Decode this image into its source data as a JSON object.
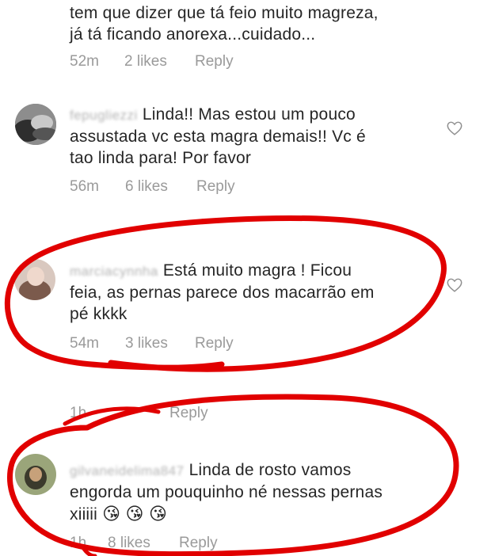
{
  "accent_color": "#e10000",
  "comments": [
    {
      "username": "",
      "text_line1": "tem que dizer que tá feio muito magreza,",
      "text_line2": "já tá ficando anorexa...cuidado...",
      "time": "52m",
      "likes": "2 likes",
      "reply": "Reply"
    },
    {
      "username": "fepugliezzi",
      "text_line1": "Linda!! Mas estou  um pouco",
      "text_line2": "assustada vc esta magra demais!! Vc é",
      "text_line3": "tao linda para! Por favor",
      "time": "56m",
      "likes": "6 likes",
      "reply": "Reply",
      "heart_icon": "heart-outline-icon"
    },
    {
      "username": "marciacynnha",
      "text_line1": "Está muito magra ! Ficou",
      "text_line2": "feia, as pernas parece dos macarrão em",
      "text_line3": "pé kkkk",
      "time": "54m",
      "likes": "3 likes",
      "reply": "Reply",
      "heart_icon": "heart-outline-icon"
    },
    {
      "username": "",
      "time": "1h",
      "likes": "",
      "reply": "Reply"
    },
    {
      "username": "gilvaneidelima847",
      "text_line1": "Linda de rosto vamos",
      "text_line2": "engorda um pouquinho né nessas pernas",
      "text_line3": "xiiiii",
      "emojis": "😘 😘 😘",
      "time": "1h",
      "likes": "8 likes",
      "reply": "Reply"
    }
  ]
}
